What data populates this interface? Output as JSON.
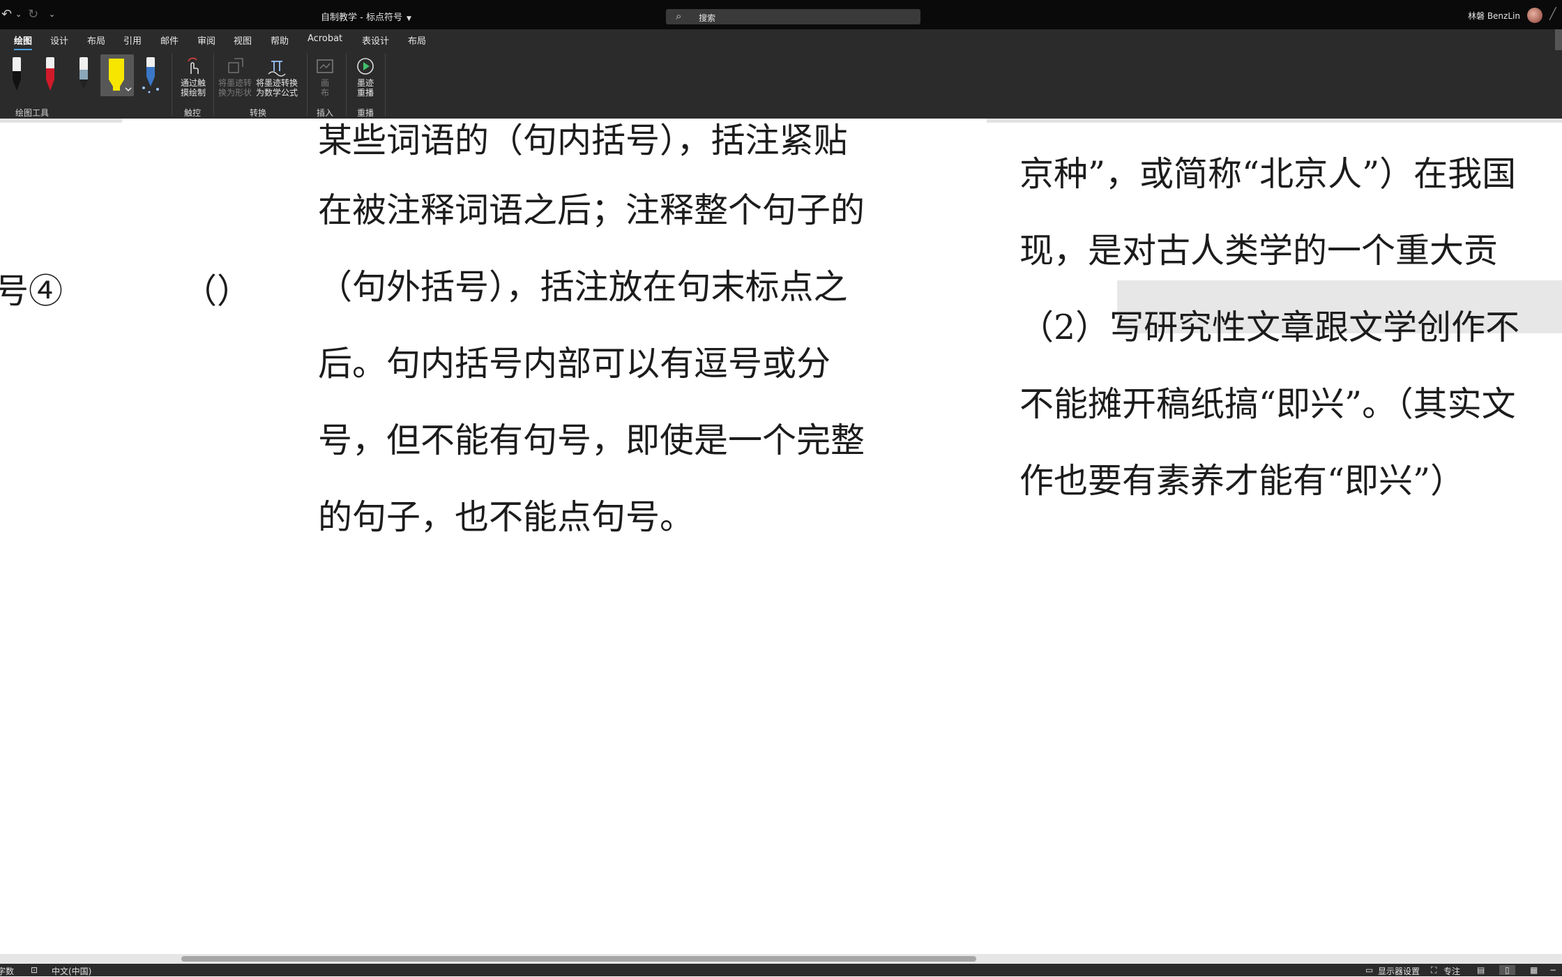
{
  "titlebar": {
    "quick_access": {
      "undo": "↶",
      "undo_caret": "⌄",
      "redo": "↻",
      "customize": "⌄"
    },
    "document_title": "自制教学 - 标点符号",
    "search_placeholder": "搜索",
    "user_name": "林磐 BenzLin"
  },
  "ribbon": {
    "tabs": [
      "绘图",
      "设计",
      "布局",
      "引用",
      "邮件",
      "审阅",
      "视图",
      "帮助",
      "Acrobat",
      "表设计",
      "布局"
    ],
    "active_tab": "绘图",
    "pens": [
      {
        "name": "black-pen",
        "color": "#111111"
      },
      {
        "name": "red-pen",
        "color": "#d01a2a"
      },
      {
        "name": "galaxy-pen",
        "color": "#8aa6b8"
      },
      {
        "name": "yellow-highlighter",
        "color": "#f7e600"
      },
      {
        "name": "blue-glitter-pen",
        "color": "#3b77c8"
      }
    ],
    "buttons": {
      "draw_with_touch": "通过触摸绘制",
      "ink_to_shape": "将墨迹转换为形状",
      "ink_to_math": "将墨迹转换为数学公式",
      "canvas": "画布",
      "ink_replay": "墨迹重播"
    },
    "groups": {
      "drawing_tools": "绘图工具",
      "touch": "触控",
      "convert": "转换",
      "insert": "插入",
      "replay": "重播"
    }
  },
  "document": {
    "left_column": {
      "cell_text": "号④",
      "placeholder": "（）"
    },
    "middle_column": [
      "某些词语的（句内括号），括注紧贴",
      "在被注释词语之后；注释整个句子的",
      "（句外括号），括注放在句末标点之",
      "后。句内括号内部可以有逗号或分",
      "号，但不能有句号，即使是一个完整",
      "的句子，也不能点句号。"
    ],
    "right_column": [
      "京种”，或简称“北京人”）在我国",
      "现，是对古人类学的一个重大贡",
      "（2）写研究性文章跟文学创作不",
      "不能摊开稿纸搞“即兴”。（其实文",
      "作也要有素养才能有“即兴”）"
    ]
  },
  "statusbar": {
    "words": "字数",
    "language": "中文(中国)",
    "display_settings": "显示器设置",
    "focus": "专注"
  }
}
